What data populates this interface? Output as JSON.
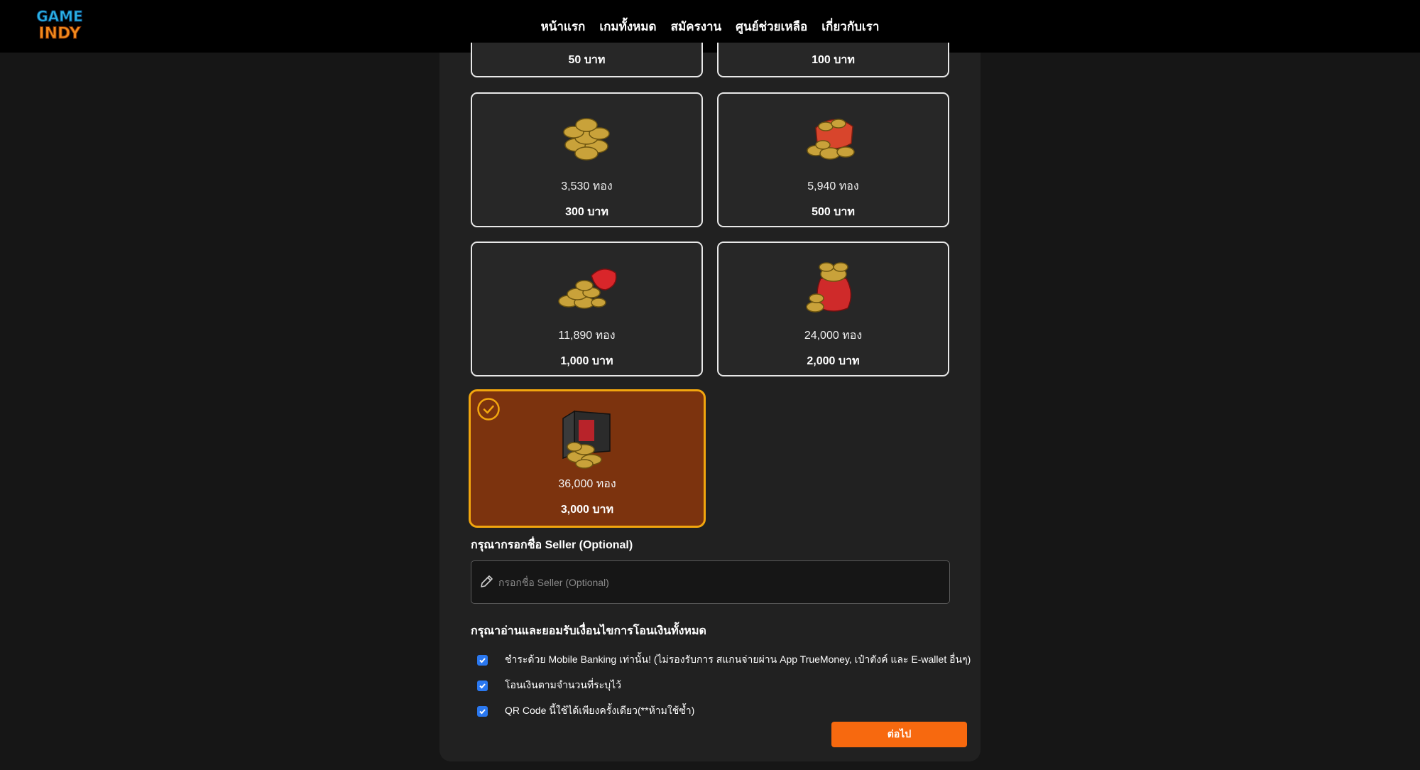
{
  "brand": {
    "logo_line1": "GAME",
    "logo_line2": "INDY"
  },
  "nav": [
    "หน้าแรก",
    "เกมทั้งหมด",
    "สมัครงาน",
    "ศูนย์ช่วยเหลือ",
    "เกี่ยวกับเรา"
  ],
  "packages": [
    {
      "gold": "",
      "price": "50 บาท"
    },
    {
      "gold": "",
      "price": "100 บาท"
    },
    {
      "gold": "3,530 ทอง",
      "price": "300 บาท"
    },
    {
      "gold": "5,940 ทอง",
      "price": "500 บาท"
    },
    {
      "gold": "11,890 ทอง",
      "price": "1,000 บาท"
    },
    {
      "gold": "24,000 ทอง",
      "price": "2,000 บาท"
    },
    {
      "gold": "36,000 ทอง",
      "price": "3,000 บาท",
      "selected": true
    }
  ],
  "seller": {
    "label": "กรุณากรอกชื่อ Seller (Optional)",
    "placeholder": "กรอกชื่อ Seller (Optional)",
    "value": ""
  },
  "terms": {
    "heading": "กรุณาอ่านและยอมรับเงื่อนไขการโอนเงินทั้งหมด",
    "items": [
      {
        "text": "ชำระด้วย Mobile Banking เท่านั้น! (ไม่รองรับการ สแกนจ่ายผ่าน App TrueMoney, เป๋าตังค์ และ E-wallet อื่นๆ)",
        "checked": true
      },
      {
        "text": "โอนเงินตามจำนวนที่ระบุไว้",
        "checked": true
      },
      {
        "text": "QR Code นี้ใช้ได้เพียงครั้งเดียว(**ห้ามใช้ซ้ำ)",
        "checked": true
      }
    ]
  },
  "next_button": "ต่อไป",
  "colors": {
    "accent": "#f7690f",
    "selected_bg": "#7c330e",
    "selected_border": "#f2a60e",
    "checkbox": "#2a78f0"
  }
}
